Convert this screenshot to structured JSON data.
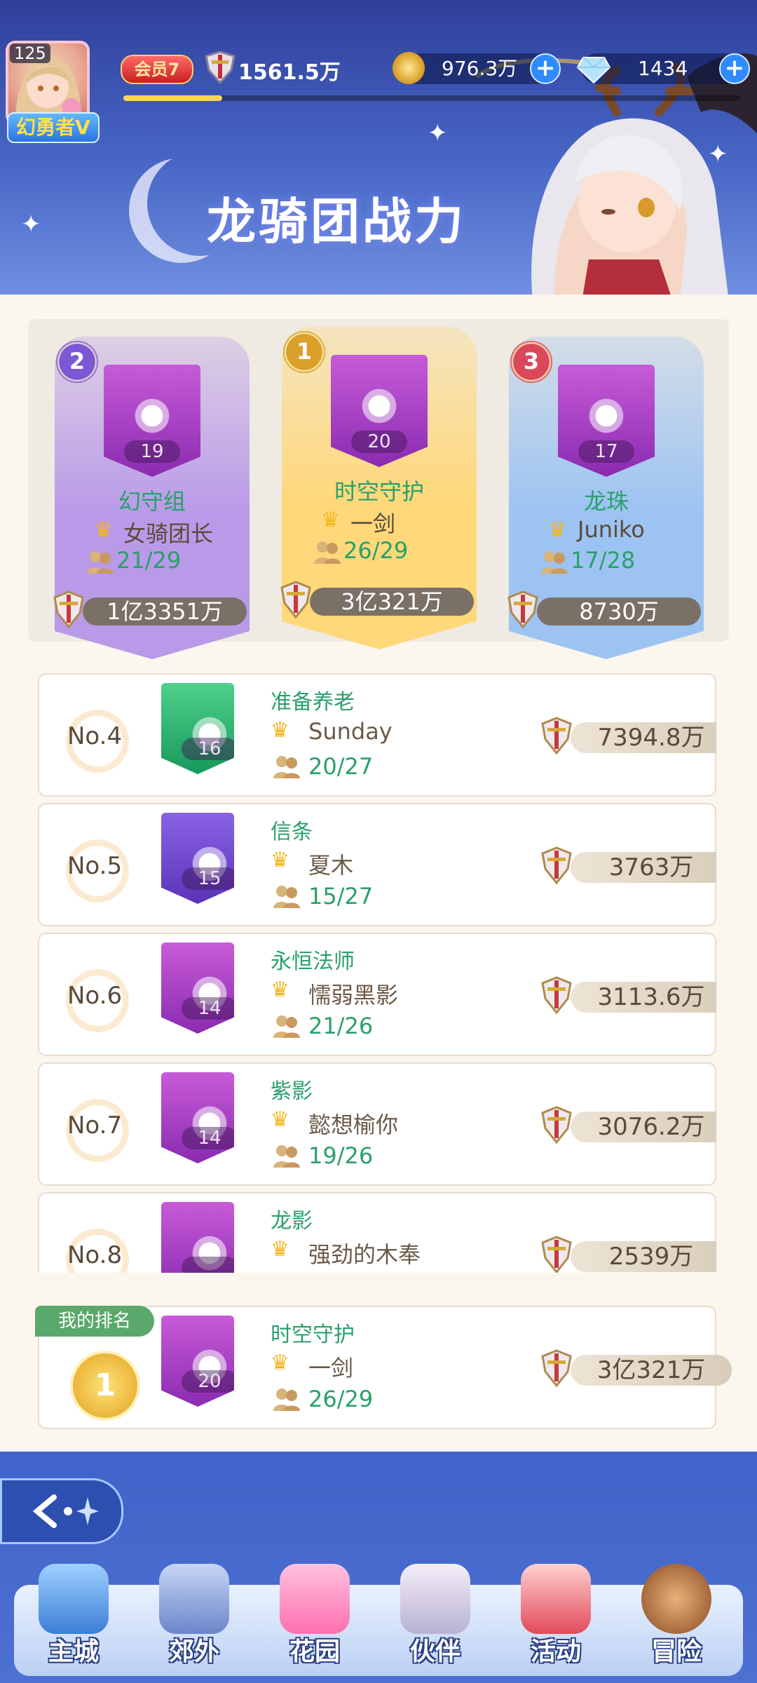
{
  "player": {
    "level": "125",
    "title_tag": "幻勇者V",
    "vip_label": "会员7",
    "power": "1561.5万",
    "xp_fraction": 0.16
  },
  "currency": {
    "gold": "976.3万",
    "gems": "1434",
    "plus": "+"
  },
  "page_title": "龙骑团战力",
  "top3": [
    {
      "rank": "2",
      "guild": "幻守组",
      "level": "19",
      "leader": "女骑团长",
      "members": "21/29",
      "power": "1亿3351万",
      "color": "#b99ae8"
    },
    {
      "rank": "1",
      "guild": "时空守护",
      "level": "20",
      "leader": "一剑",
      "members": "26/29",
      "power": "3亿321万",
      "color": "#ffd87a"
    },
    {
      "rank": "3",
      "guild": "龙珠",
      "level": "17",
      "leader": "Juniko",
      "members": "17/28",
      "power": "8730万",
      "color": "#9cc3f2"
    }
  ],
  "rankings": [
    {
      "no": "No.4",
      "guild": "准备养老",
      "level": "16",
      "leader": "Sunday",
      "members": "20/27",
      "power": "7394.8万",
      "emblem": "green"
    },
    {
      "no": "No.5",
      "guild": "信条",
      "level": "15",
      "leader": "夏木",
      "members": "15/27",
      "power": "3763万",
      "emblem": "violet"
    },
    {
      "no": "No.6",
      "guild": "永恒法师",
      "level": "14",
      "leader": "懦弱黑影",
      "members": "21/26",
      "power": "3113.6万",
      "emblem": "purple"
    },
    {
      "no": "No.7",
      "guild": "紫影",
      "level": "14",
      "leader": "懿想榆你",
      "members": "19/26",
      "power": "3076.2万",
      "emblem": "purple"
    },
    {
      "no": "No.8",
      "guild": "龙影",
      "level": "",
      "leader": "强劲的木奉",
      "members": "",
      "power": "2539万",
      "emblem": "purple"
    }
  ],
  "my_rank": {
    "tag": "我的排名",
    "rank": "1",
    "guild": "时空守护",
    "level": "20",
    "leader": "一剑",
    "members": "26/29",
    "power": "3亿321万"
  },
  "nav": {
    "items": [
      {
        "label": "主城",
        "icon": "castle-icon"
      },
      {
        "label": "郊外",
        "icon": "portal-icon"
      },
      {
        "label": "花园",
        "icon": "heart-icon"
      },
      {
        "label": "伙伴",
        "icon": "companion-icon"
      },
      {
        "label": "活动",
        "icon": "gift-icon"
      },
      {
        "label": "冒险",
        "icon": "compass-icon"
      }
    ]
  },
  "colors": {
    "accent_green": "#2aa06a",
    "panel_bg": "#fbf6ee",
    "header_blue": "#4866c6"
  }
}
